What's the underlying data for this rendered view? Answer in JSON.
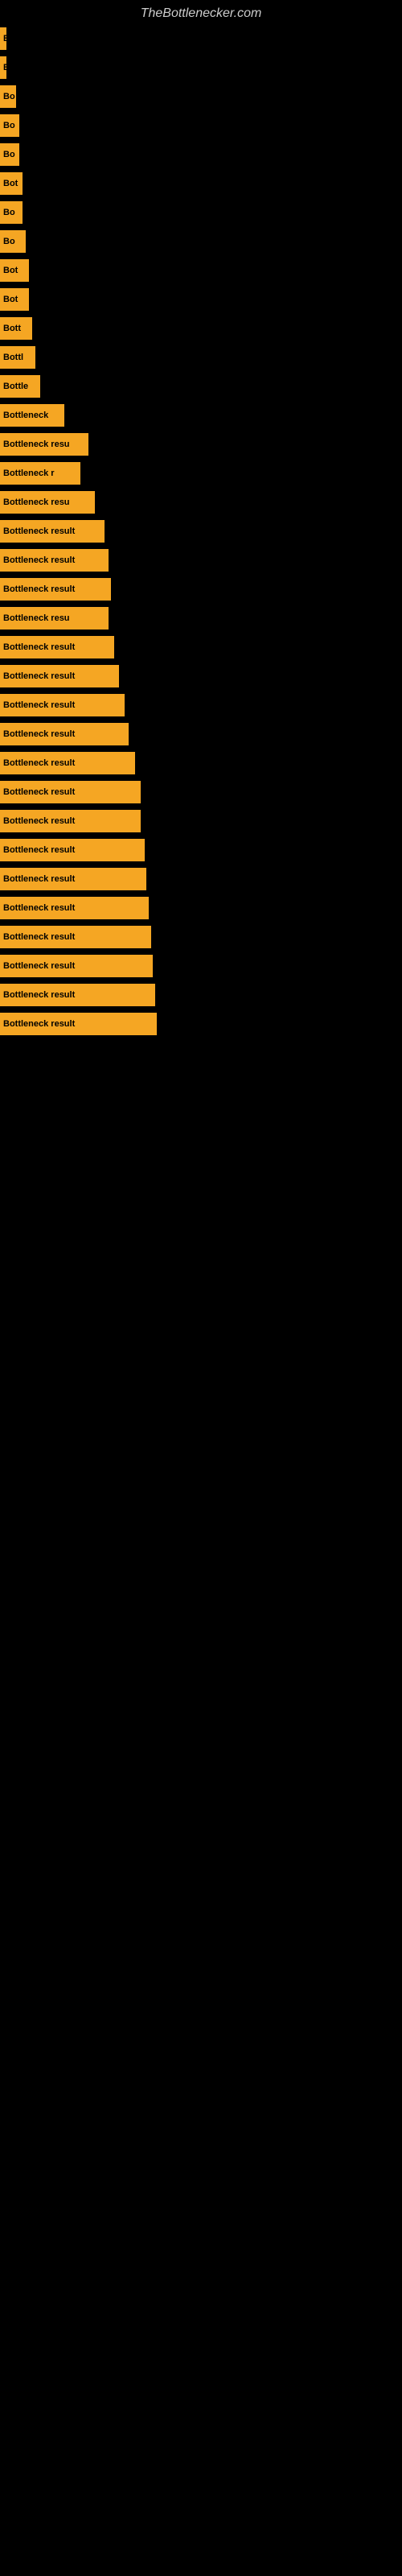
{
  "site_title": "TheBottlenecker.com",
  "bars": [
    {
      "label": "B",
      "width": 8
    },
    {
      "label": "B",
      "width": 8
    },
    {
      "label": "Bo",
      "width": 20
    },
    {
      "label": "Bo",
      "width": 24
    },
    {
      "label": "Bo",
      "width": 24
    },
    {
      "label": "Bot",
      "width": 28
    },
    {
      "label": "Bo",
      "width": 28
    },
    {
      "label": "Bo",
      "width": 32
    },
    {
      "label": "Bot",
      "width": 36
    },
    {
      "label": "Bot",
      "width": 36
    },
    {
      "label": "Bott",
      "width": 40
    },
    {
      "label": "Bottl",
      "width": 44
    },
    {
      "label": "Bottle",
      "width": 50
    },
    {
      "label": "Bottleneck",
      "width": 80
    },
    {
      "label": "Bottleneck resu",
      "width": 110
    },
    {
      "label": "Bottleneck r",
      "width": 100
    },
    {
      "label": "Bottleneck resu",
      "width": 118
    },
    {
      "label": "Bottleneck result",
      "width": 130
    },
    {
      "label": "Bottleneck result",
      "width": 135
    },
    {
      "label": "Bottleneck result",
      "width": 138
    },
    {
      "label": "Bottleneck resu",
      "width": 135
    },
    {
      "label": "Bottleneck result",
      "width": 142
    },
    {
      "label": "Bottleneck result",
      "width": 148
    },
    {
      "label": "Bottleneck result",
      "width": 155
    },
    {
      "label": "Bottleneck result",
      "width": 160
    },
    {
      "label": "Bottleneck result",
      "width": 168
    },
    {
      "label": "Bottleneck result",
      "width": 175
    },
    {
      "label": "Bottleneck result",
      "width": 175
    },
    {
      "label": "Bottleneck result",
      "width": 180
    },
    {
      "label": "Bottleneck result",
      "width": 182
    },
    {
      "label": "Bottleneck result",
      "width": 185
    },
    {
      "label": "Bottleneck result",
      "width": 188
    },
    {
      "label": "Bottleneck result",
      "width": 190
    },
    {
      "label": "Bottleneck result",
      "width": 193
    },
    {
      "label": "Bottleneck result",
      "width": 195
    }
  ]
}
